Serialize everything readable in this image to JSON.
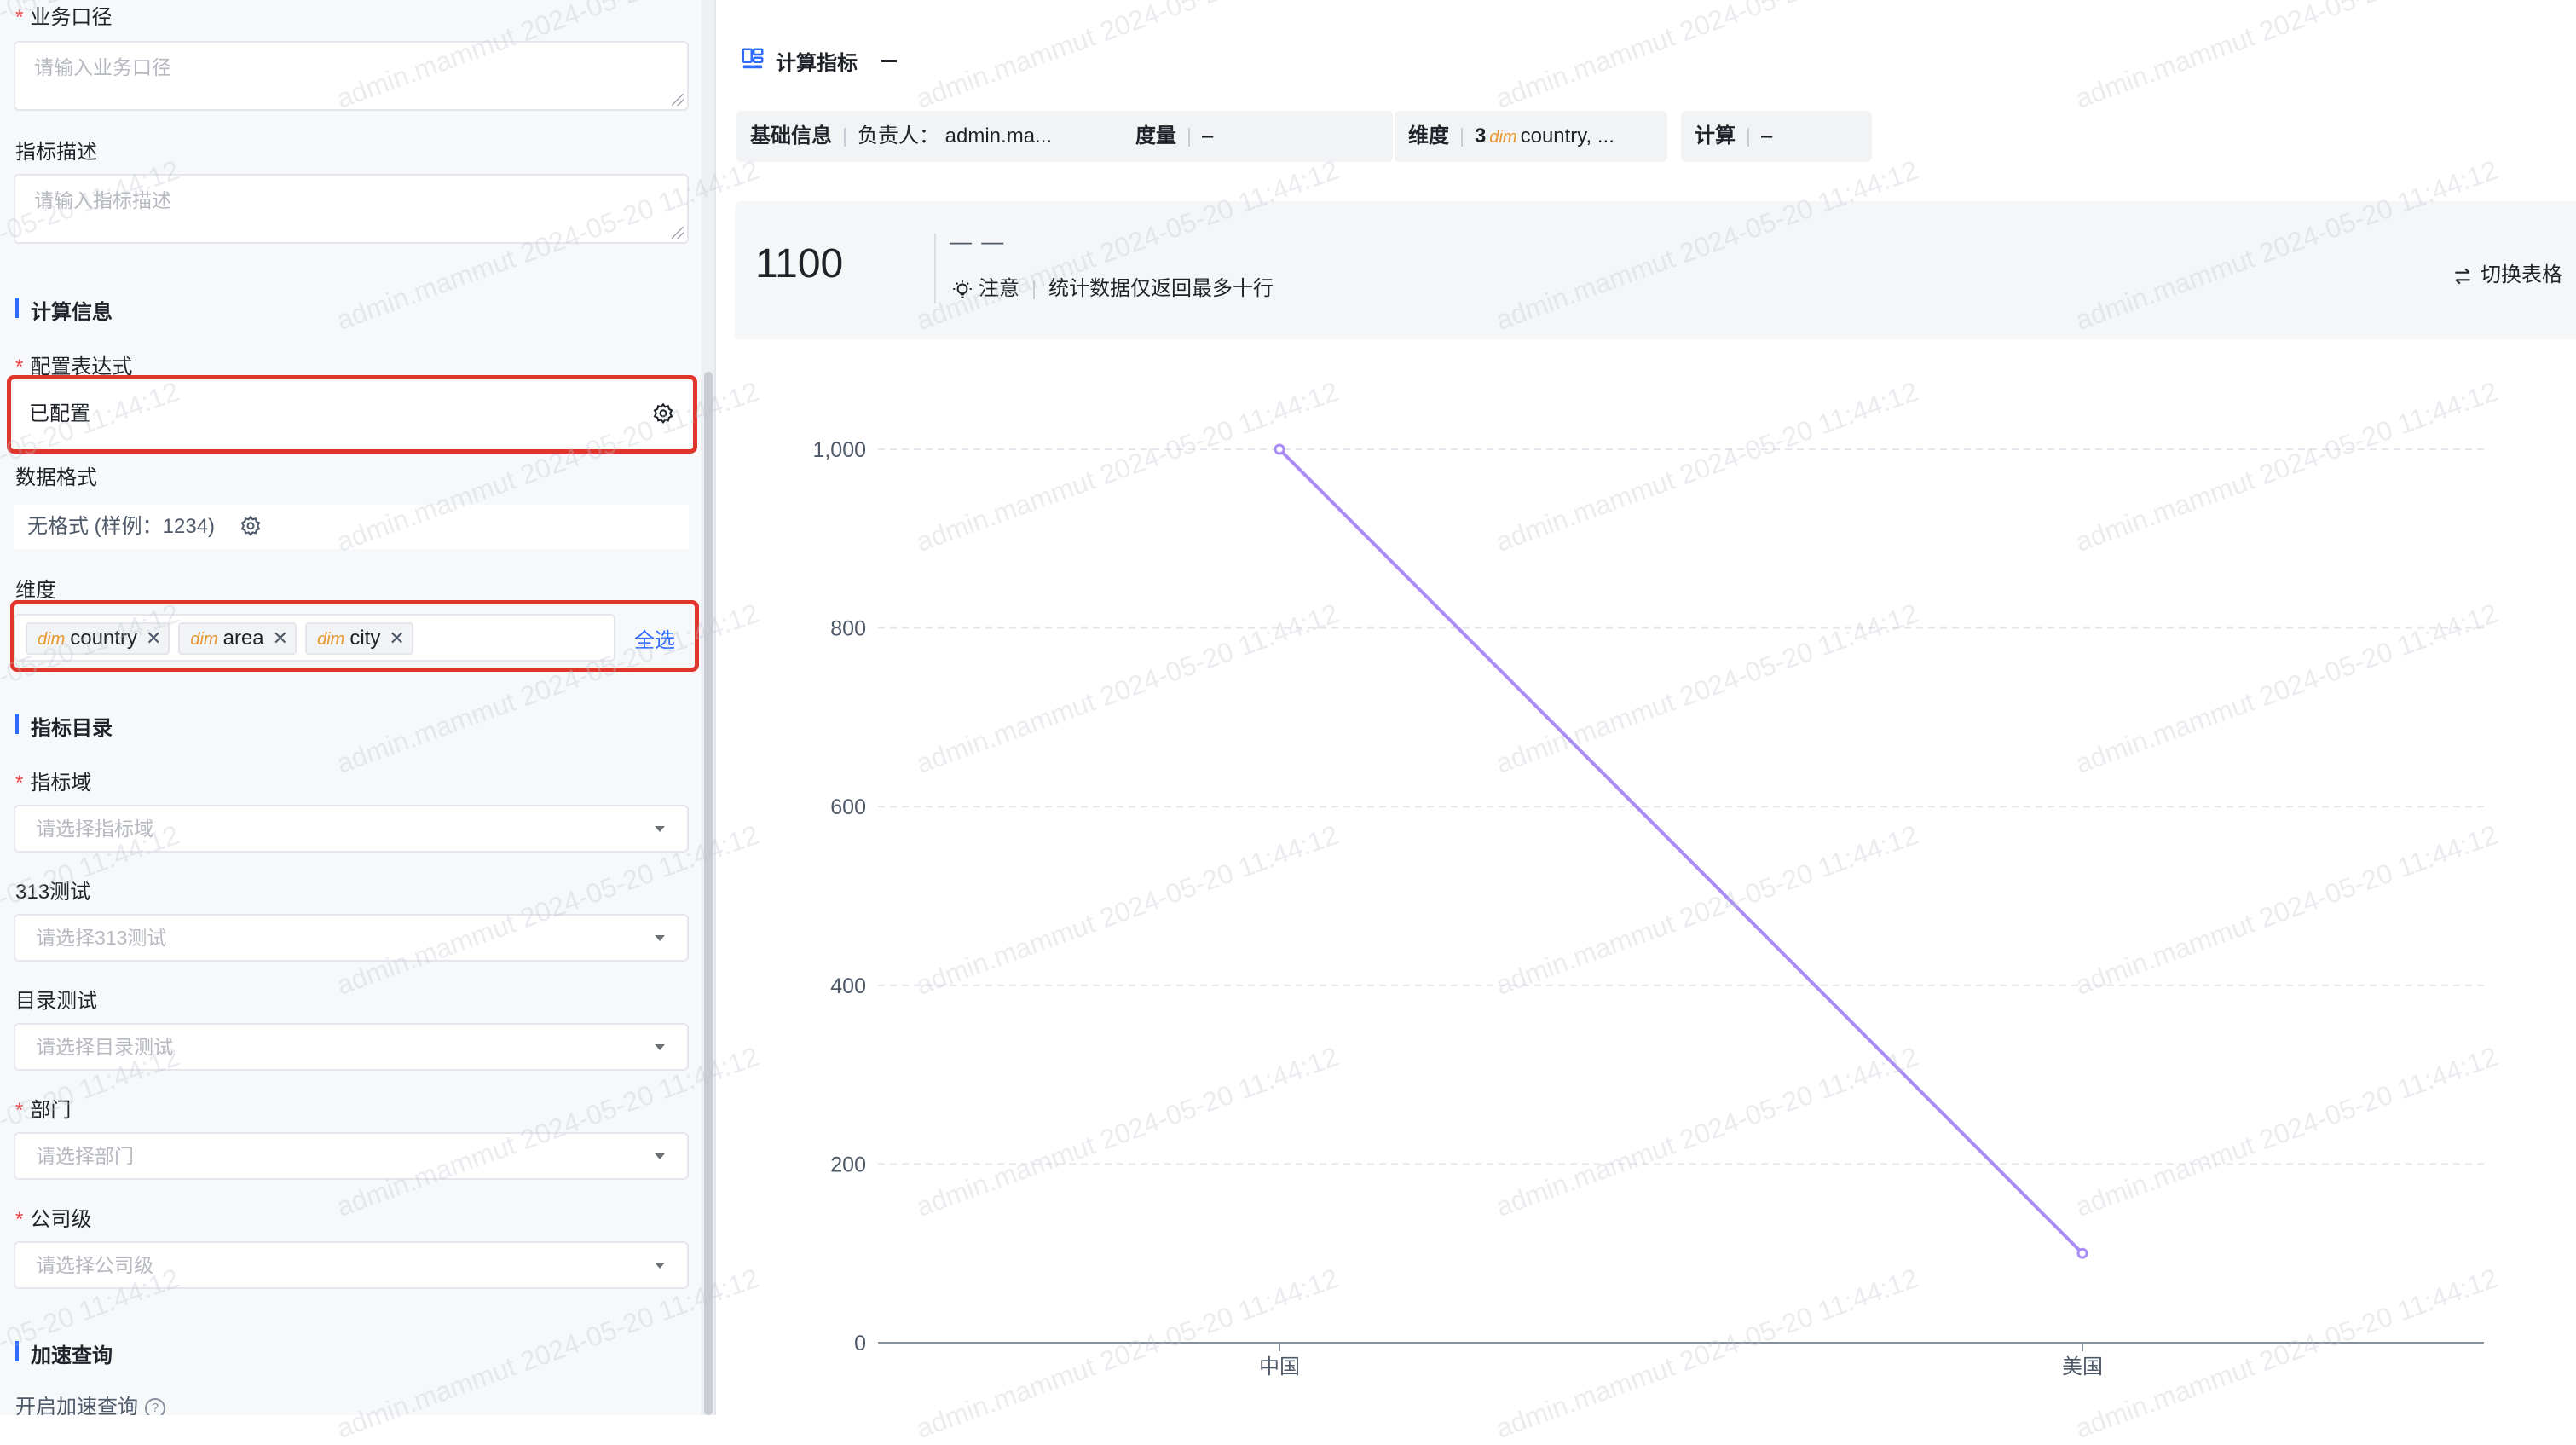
{
  "form": {
    "business_caliber": {
      "label": "业务口径",
      "placeholder": "请输入业务口径"
    },
    "metric_desc": {
      "label": "指标描述",
      "placeholder": "请输入指标描述"
    },
    "calc_section": "计算信息",
    "expression": {
      "label": "配置表达式",
      "value": "已配置"
    },
    "data_format": {
      "label": "数据格式",
      "value": "无格式 (样例：1234)"
    },
    "dimensions": {
      "label": "维度",
      "tag_prefix": "dim",
      "tags": [
        "country",
        "area",
        "city"
      ],
      "select_all": "全选"
    },
    "catalog_section": "指标目录",
    "metric_domain": {
      "label": "指标域",
      "placeholder": "请选择指标域"
    },
    "test313": {
      "label": "313测试",
      "placeholder": "请选择313测试"
    },
    "catalog_test": {
      "label": "目录测试",
      "placeholder": "请选择目录测试"
    },
    "department": {
      "label": "部门",
      "placeholder": "请选择部门"
    },
    "company_level": {
      "label": "公司级",
      "placeholder": "请选择公司级"
    },
    "accel_section": "加速查询",
    "accel_toggle": "开启加速查询"
  },
  "preview": {
    "title": "计算指标",
    "info": {
      "basic_label": "基础信息",
      "owner": "负责人： admin.ma...",
      "measure_label": "度量",
      "measure_value": "–",
      "dim_label": "维度",
      "dim_count": "3",
      "dim_prefix": "dim",
      "dim_value": "country, ...",
      "calc_label": "计算",
      "calc_value": "–"
    },
    "big_value": "1100",
    "dash_value": "— —",
    "note_label": "注意",
    "note_text": "统计数据仅返回最多十行",
    "switch_label": "切换表格"
  },
  "watermark": "admin.mammut 2024-05-20 11:44:12",
  "colors": {
    "accent": "#2f6bff",
    "line": "#a98cf5",
    "highlight": "#e0352b",
    "dim_tag": "#e8962e"
  },
  "chart_data": {
    "type": "line",
    "categories": [
      "中国",
      "美国"
    ],
    "values": [
      1000,
      100
    ],
    "ylim": [
      0,
      1000
    ],
    "yticks": [
      0,
      200,
      400,
      600,
      800,
      1000
    ],
    "ytick_labels": [
      "0",
      "200",
      "400",
      "600",
      "800",
      "1,000"
    ],
    "grid": true
  }
}
